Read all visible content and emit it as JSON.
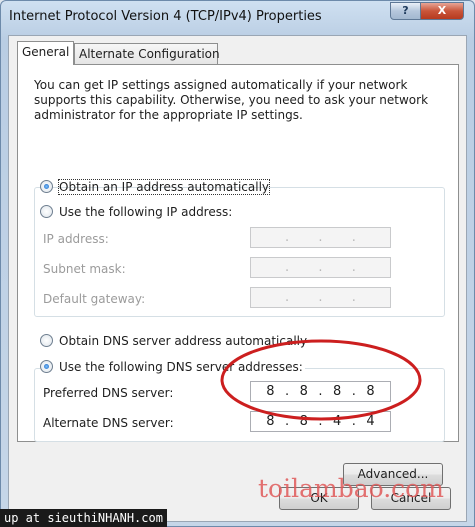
{
  "window": {
    "title": "Internet Protocol Version 4 (TCP/IPv4) Properties",
    "help_label": "?",
    "close_label": "X"
  },
  "tabs": [
    {
      "label": "General",
      "active": true
    },
    {
      "label": "Alternate Configuration",
      "active": false
    }
  ],
  "info_text": "You can get IP settings assigned automatically if your network supports this capability. Otherwise, you need to ask your network administrator for the appropriate IP settings.",
  "ip_section": {
    "auto_label": "Obtain an IP address automatically",
    "manual_label": "Use the following IP address:",
    "auto_selected": true,
    "fields": [
      {
        "label": "IP address:",
        "octets": [
          "",
          "",
          "",
          ""
        ]
      },
      {
        "label": "Subnet mask:",
        "octets": [
          "",
          "",
          "",
          ""
        ]
      },
      {
        "label": "Default gateway:",
        "octets": [
          "",
          "",
          "",
          ""
        ]
      }
    ]
  },
  "dns_section": {
    "auto_label": "Obtain DNS server address automatically",
    "manual_label": "Use the following DNS server addresses:",
    "manual_selected": true,
    "preferred": {
      "label": "Preferred DNS server:",
      "octets": [
        "8",
        "8",
        "8",
        "8"
      ]
    },
    "alternate": {
      "label": "Alternate DNS server:",
      "octets": [
        "8",
        "8",
        "4",
        "4"
      ]
    }
  },
  "buttons": {
    "advanced": "Advanced...",
    "ok": "OK",
    "cancel": "Cancel"
  },
  "overlay": {
    "watermark": "toilambao.com",
    "credit": "up at sieuthiNHANH.com"
  },
  "colors": {
    "highlight_ellipse": "#cc1f1f",
    "watermark": "#e05a5a"
  }
}
